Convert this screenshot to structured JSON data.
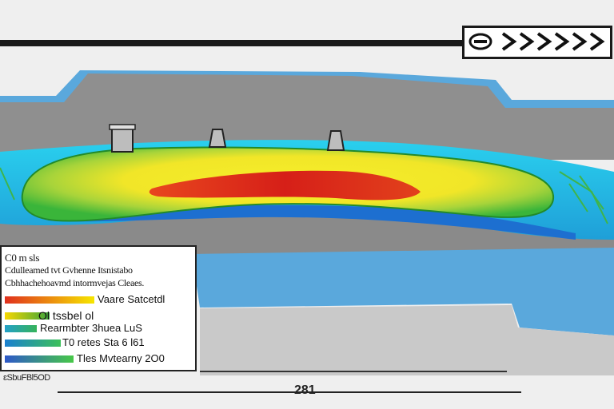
{
  "legend": {
    "heading": "C0 m sls",
    "subtitle_1": "Cdulleamed tvt Gvhenne Itsnistabo",
    "subtitle_2": "Cbhhachehoavmd intormvejas Cleaes.",
    "items": [
      {
        "label": "Vaare Satcetdl",
        "color_from": "#e0301e",
        "color_to": "#f6e600"
      },
      {
        "label": "Ol tssbel ol",
        "color_from": "#f7d700",
        "color_to": "#3aa63a"
      },
      {
        "label": "Rearmbter 3huea LuS",
        "color_from": "#23a0c8",
        "color_to": "#36b35a"
      },
      {
        "label": "T0 retes Sta 6 l61",
        "color_from": "#1a7fd0",
        "color_to": "#3cc05a"
      },
      {
        "label": "Tles Mvtearny 2O0",
        "color_from": "#2d58c8",
        "color_to": "#47c848"
      }
    ]
  },
  "footer": {
    "left_text": "ɛSbuFBl5OD",
    "page_number": "281"
  },
  "colors": {
    "road_gray": "#8c8c8c",
    "water_blue": "#5ba9dc",
    "hot_red": "#d9261c",
    "warm_yellow": "#f3e41a",
    "cool_green": "#3db43a",
    "cyan": "#26c6e6"
  },
  "icons": [
    "chevron-right-icon",
    "oval-logo-icon",
    "sensor-tower-icon"
  ]
}
